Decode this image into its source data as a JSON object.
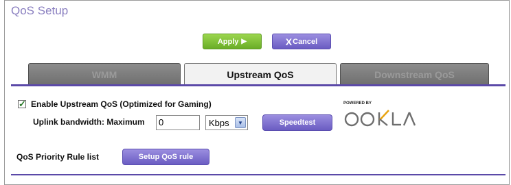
{
  "page": {
    "title": "QoS Setup"
  },
  "toolbar": {
    "apply_label": "Apply",
    "apply_glyph": "▶",
    "cancel_glyph": "X",
    "cancel_label": "Cancel"
  },
  "tabs": [
    {
      "label": "WMM",
      "active": false
    },
    {
      "label": "Upstream QoS",
      "active": true
    },
    {
      "label": "Downstream QoS",
      "active": false
    }
  ],
  "upstream": {
    "enable_label": "Enable Upstream QoS (Optimized for Gaming)",
    "enable_checked": true,
    "bandwidth_label": "Uplink bandwidth: Maximum",
    "bandwidth_value": "0",
    "unit_selected": "Kbps",
    "speedtest_label": "Speedtest"
  },
  "branding": {
    "powered_by": "POWERED BY",
    "logo_text": "OOKLA",
    "logo_color": "#6e6e6e",
    "logo_accent": "#e8a413"
  },
  "rules": {
    "list_label": "QoS Priority Rule list",
    "setup_button_label": "Setup QoS rule"
  },
  "colors": {
    "accent": "#5b49a8",
    "title": "#8a7fc0",
    "apply": "#7ab833",
    "purple_button": "#7b6dd0"
  }
}
